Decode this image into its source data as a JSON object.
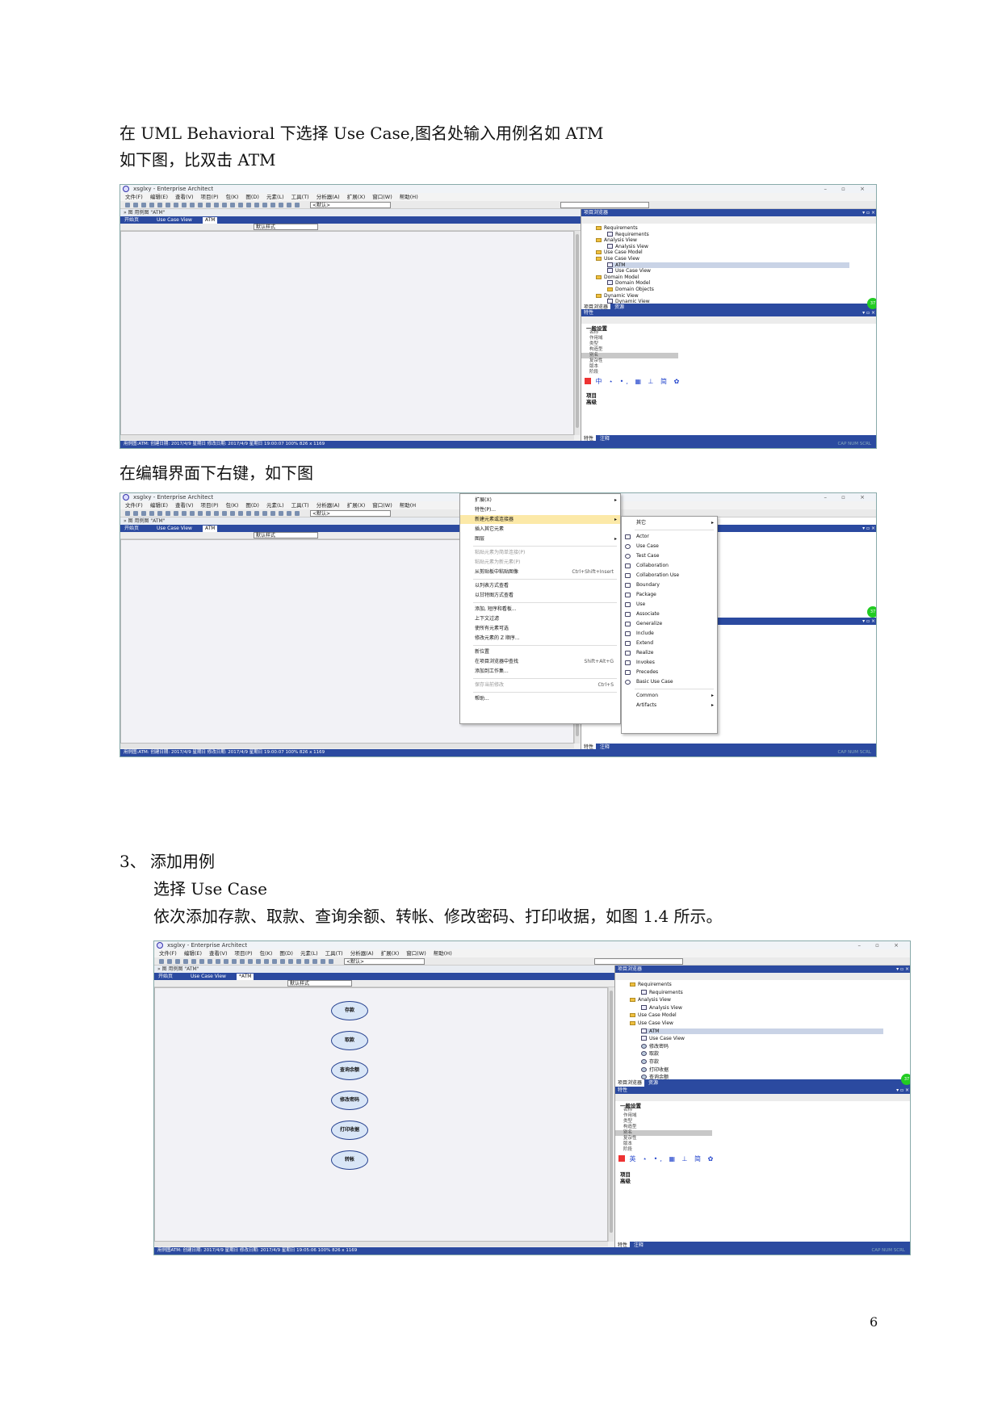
{
  "doc": {
    "line1": "在 UML Behavioral  下选择 Use Case,图名处输入用例名如 ATM",
    "line2": "如下图，比双击 ATM",
    "line3": "在编辑界面下右键，如下图",
    "section_num": "3、",
    "section_title": "添加用例",
    "line4": "选择 Use Case",
    "line5": "依次添加存款、取款、查询余额、转帐、修改密码、打印收据，如图 1.4 所示。",
    "page_number": "6"
  },
  "app": {
    "title": "xsglxy - Enterprise Architect",
    "window_controls": "– ▫ ×",
    "menus_a": [
      "文件(F)",
      "编辑(E)",
      "查看(V)",
      "项目(P)",
      "包(K)",
      "图(D)",
      "元素(L)",
      "工具(T)",
      "分析器(A)",
      "扩展(X)",
      "窗口(W)",
      "帮助(H)"
    ],
    "menus_b": [
      "文件(F)",
      "编辑(E)",
      "查看(V)",
      "项目(P)",
      "包(K)",
      "图(D)",
      "元素(L)",
      "工具(T)",
      "分析器(A)",
      "扩展(X)",
      "窗口(W)",
      "帮助(H"
    ],
    "default_combo": "<默认>",
    "diagram_header": "» 图   用例图 \"ATM\"",
    "tabs": [
      "开始页",
      "Use Case View",
      "ATM"
    ],
    "tab_title_c": "*ATM",
    "style_combo": "默认样式",
    "project_browser": "项目浏览器",
    "properties": "特性",
    "panel_controls": "▾ ▫ ×",
    "status_a": "用例图:ATM:  创建日期: 2017/4/9 星期日  修改日期: 2017/4/9 星期日 19:00:07   100%   826 x 1169",
    "status_b": "用例图:ATM:  创建日期: 2017/4/9 星期日  修改日期: 2017/4/9 星期日 19:00:07   100%   826 x 1169",
    "status_c": "用例图ATM:  创建日期: 2017/4/9 星期日  修改日期: 2017/4/9 星期日 19:05:06   100%   826 x 1169",
    "status_right": "CAP   NUM   SCRL",
    "bottom_tabs": [
      "特性",
      "注释"
    ],
    "browser_tabs": [
      "项目浏览器",
      "资源"
    ],
    "green_badge": "37"
  },
  "tree_a": [
    {
      "t": "Requirements",
      "lvl": 1,
      "k": "folder"
    },
    {
      "t": "Requirements",
      "lvl": 2,
      "k": "diagram"
    },
    {
      "t": "Analysis View",
      "lvl": 1,
      "k": "folder"
    },
    {
      "t": "Analysis View",
      "lvl": 2,
      "k": "diagram"
    },
    {
      "t": "Use Case Model",
      "lvl": 1,
      "k": "folder"
    },
    {
      "t": "Use Case View",
      "lvl": 1,
      "k": "folder"
    },
    {
      "t": "ATM",
      "lvl": 2,
      "k": "diagram",
      "sel": true
    },
    {
      "t": "Use Case View",
      "lvl": 2,
      "k": "diagram"
    },
    {
      "t": "Domain Model",
      "lvl": 1,
      "k": "folder"
    },
    {
      "t": "Domain Model",
      "lvl": 2,
      "k": "diagram"
    },
    {
      "t": "Domain Objects",
      "lvl": 2,
      "k": "folder"
    },
    {
      "t": "Dynamic View",
      "lvl": 1,
      "k": "folder"
    },
    {
      "t": "Dynamic View",
      "lvl": 2,
      "k": "diagram"
    }
  ],
  "tree_c": [
    {
      "t": "Requirements",
      "lvl": 1,
      "k": "folder"
    },
    {
      "t": "Requirements",
      "lvl": 2,
      "k": "diagram"
    },
    {
      "t": "Analysis View",
      "lvl": 1,
      "k": "folder"
    },
    {
      "t": "Analysis View",
      "lvl": 2,
      "k": "diagram"
    },
    {
      "t": "Use Case Model",
      "lvl": 1,
      "k": "folder"
    },
    {
      "t": "Use Case View",
      "lvl": 1,
      "k": "folder"
    },
    {
      "t": "ATM",
      "lvl": 2,
      "k": "diagram",
      "sel": true
    },
    {
      "t": "Use Case View",
      "lvl": 2,
      "k": "diagram"
    },
    {
      "t": "修改密码",
      "lvl": 2,
      "k": "uc"
    },
    {
      "t": "取款",
      "lvl": 2,
      "k": "uc"
    },
    {
      "t": "存款",
      "lvl": 2,
      "k": "uc"
    },
    {
      "t": "打印收据",
      "lvl": 2,
      "k": "uc"
    },
    {
      "t": "查询余额",
      "lvl": 2,
      "k": "uc"
    }
  ],
  "props": {
    "section": "一般设置",
    "rows": [
      "名称",
      "作用域",
      "类型",
      "构造型",
      "别名",
      "复杂性",
      "版本",
      "阶段"
    ],
    "selected_index": 4,
    "sec2": "项目",
    "sec3": "高级"
  },
  "ctx_menu": [
    {
      "t": "扩展(X)",
      "ar": true
    },
    {
      "t": "特性(P)..."
    },
    {
      "t": "新建元素或连接器",
      "ar": true,
      "hl": true
    },
    {
      "t": "插入其它元素"
    },
    {
      "t": "图层",
      "ar": true
    },
    {
      "t": "sep"
    },
    {
      "t": "粘贴元素为简单连接(P)",
      "dis": true
    },
    {
      "t": "粘贴元素为新元素(P)",
      "dis": true
    },
    {
      "t": "从剪贴板中粘贴图像",
      "sc": "Ctrl+Shift+Insert"
    },
    {
      "t": "sep"
    },
    {
      "t": "以列表方式查看"
    },
    {
      "t": "以甘特图方式查看"
    },
    {
      "t": "sep"
    },
    {
      "t": "添加, 短序和看板..."
    },
    {
      "t": "上下文过滤"
    },
    {
      "t": "使所有元素可选"
    },
    {
      "t": "修改元素的 Z 顺序..."
    },
    {
      "t": "sep"
    },
    {
      "t": "新位置"
    },
    {
      "t": "在项目浏览器中查找",
      "sc": "Shift+Alt+G"
    },
    {
      "t": "添加到工作集..."
    },
    {
      "t": "sep"
    },
    {
      "t": "保存当前修改",
      "sc": "Ctrl+S",
      "dis": true
    },
    {
      "t": "sep"
    },
    {
      "t": "帮助..."
    }
  ],
  "sub_menu": [
    {
      "t": "其它",
      "ar": true
    },
    {
      "t": "sep"
    },
    {
      "t": "Actor",
      "i": "actor-icon"
    },
    {
      "t": "Use Case",
      "i": "use-case-icon"
    },
    {
      "t": "Test Case",
      "i": "test-case-icon"
    },
    {
      "t": "Collaboration",
      "i": "collaboration-icon"
    },
    {
      "t": "Collaboration Use",
      "i": "collaboration-use-icon"
    },
    {
      "t": "Boundary",
      "i": "boundary-icon"
    },
    {
      "t": "Package",
      "i": "package-icon"
    },
    {
      "t": "Use",
      "i": "use-icon"
    },
    {
      "t": "Associate",
      "i": "associate-icon"
    },
    {
      "t": "Generalize",
      "i": "generalize-icon"
    },
    {
      "t": "Include",
      "i": "include-icon"
    },
    {
      "t": "Extend",
      "i": "extend-icon"
    },
    {
      "t": "Realize",
      "i": "realize-icon"
    },
    {
      "t": "Invokes",
      "i": "invokes-icon"
    },
    {
      "t": "Precedes",
      "i": "precedes-icon"
    },
    {
      "t": "Basic Use Case",
      "i": "basic-use-case-icon"
    },
    {
      "t": "sep"
    },
    {
      "t": "Common",
      "ar": true
    },
    {
      "t": "Artifacts",
      "ar": true
    }
  ],
  "use_cases": [
    "存款",
    "取款",
    "查询余额",
    "修改密码",
    "打印收据",
    "转帐"
  ],
  "ime_text": "中 ⋆ •, ▦ ⊥ 简 ✿",
  "ime_text_c": "英 ⋆ •, ▦ ⊥ 简 ✿"
}
